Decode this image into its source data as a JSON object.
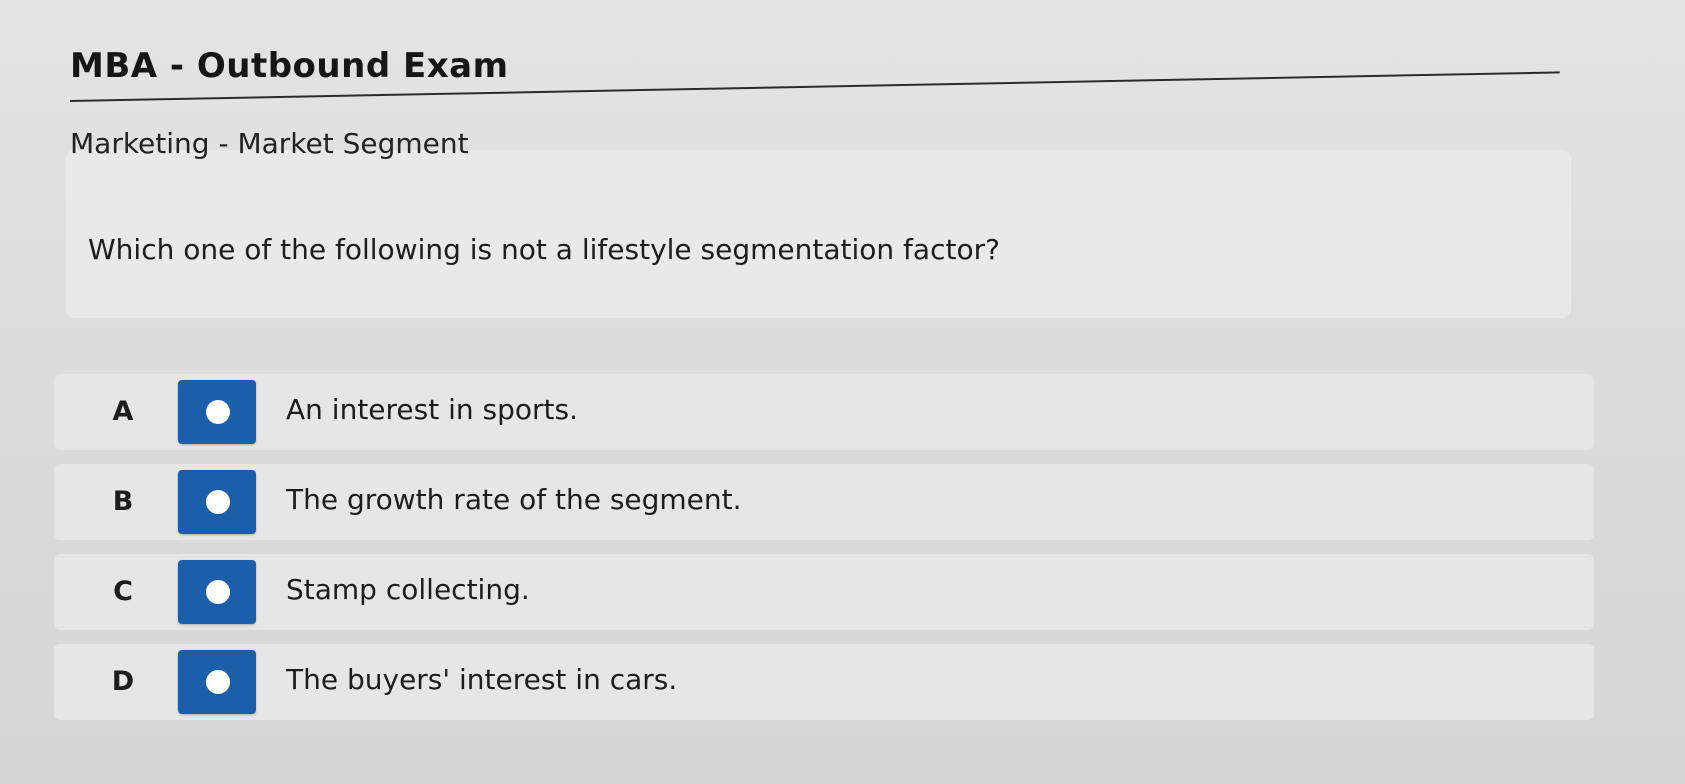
{
  "header": {
    "title": "MBA - Outbound Exam"
  },
  "section": {
    "title": "Marketing - Market Segment"
  },
  "question": {
    "text": "Which one of the following is not a lifestyle segmentation factor?"
  },
  "options": [
    {
      "letter": "A",
      "text": "An interest in sports."
    },
    {
      "letter": "B",
      "text": "The growth rate of the segment."
    },
    {
      "letter": "C",
      "text": "Stamp collecting."
    },
    {
      "letter": "D",
      "text": "The buyers' interest in cars."
    }
  ],
  "colors": {
    "radio_button": "#1b5eaa",
    "radio_dot": "#ffffff"
  }
}
